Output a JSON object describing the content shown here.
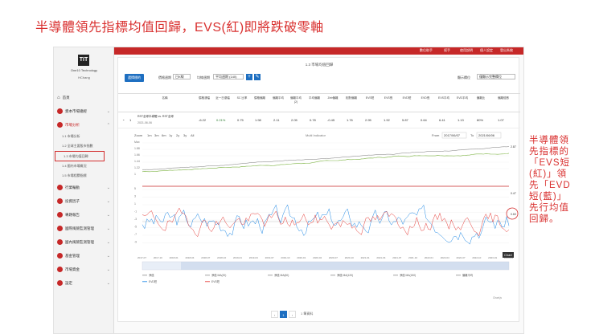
{
  "slide": {
    "title": "半導體領先指標均值回歸，EVS(紅)即將跌破零軸",
    "note_lines": [
      "半導體領",
      "先指標的",
      "「EVS短",
      "(紅)」領",
      "先「EVD",
      "短(藍)」",
      "先行均值",
      "回歸。"
    ],
    "annotation_circle_value": "0.60"
  },
  "sidebar": {
    "logo_mark": "TIT",
    "logo_text": "One10 Technology",
    "user": "HChang",
    "items": [
      {
        "label": "首頁",
        "active": false
      },
      {
        "label": "資本市場總經",
        "active": false
      },
      {
        "label": "市場分析",
        "active": true
      },
      {
        "label": "行業輪動",
        "active": false
      },
      {
        "label": "投資因子",
        "active": false
      },
      {
        "label": "專題報告",
        "active": false
      },
      {
        "label": "國際風險監測管理",
        "active": false
      },
      {
        "label": "國內風險監測管理",
        "active": false
      },
      {
        "label": "基金管理",
        "active": false
      },
      {
        "label": "市場資金",
        "active": false
      },
      {
        "label": "設定",
        "active": false
      }
    ],
    "subitems": [
      {
        "label": "1.1 市場分析",
        "active": false
      },
      {
        "label": "1.2 全球主要股市指數",
        "active": false
      },
      {
        "label": "1.3 市場均值回歸",
        "active": true
      },
      {
        "label": "1.4 國內市場概況",
        "active": false
      },
      {
        "label": "1.5 市場相關指標",
        "active": false
      }
    ]
  },
  "topbar": {
    "links": [
      "數位助手",
      "幫手",
      "使用說明",
      "個人設定",
      "登出系統"
    ]
  },
  "panel": {
    "title": "1.3 市場均值回歸",
    "add_button": "選擇標的",
    "freq_label": "價格週期",
    "freq_value": "日K線",
    "ma_label": "均線週期",
    "ma_value": "平均週期 (140)",
    "display_label": "顯示欄位",
    "display_value": "僅顯示完整欄位"
  },
  "table": {
    "headers": [
      "名稱",
      "價格漲幅",
      "近一日漲幅",
      "SC 比率",
      "價格偏離",
      "偏離平均",
      "偏離平均(2)",
      "平均偏離",
      "Zeb偏離",
      "相對偏離",
      "EVS短",
      "EVS長",
      "EVD短",
      "EVD長",
      "EVS平均",
      "EVD平均",
      "偏離比",
      "偏離倍數"
    ],
    "row": {
      "index": "1",
      "name": "RST全球半導體 vs. RST全球",
      "date": "2021-06-06",
      "values": [
        "-6.22",
        "0.21%",
        "0.75",
        "1.98",
        "2.11",
        "2.05",
        "0.78",
        "-0.45",
        "1.76",
        "2.95",
        "1.92",
        "5.87",
        "0.64",
        "6.41",
        "1.13",
        "80%",
        "1.07"
      ]
    }
  },
  "chart": {
    "zoom_label": "Zoom",
    "zoom_buttons": [
      "1m",
      "3m",
      "6m",
      "1y",
      "2y",
      "3y",
      "All"
    ],
    "center_label": "Multi Indicator",
    "from_label": "From",
    "from_value": "2017/06/07",
    "to_label": "To",
    "to_value": "2021/06/06",
    "tooltip": "Chart",
    "right_labels": [
      "2.87",
      "0.47",
      "0.60"
    ],
    "left_ticks": [
      "Max",
      "1.88",
      "1.66",
      "1.44",
      "1.22",
      "1",
      "5",
      "3",
      "1",
      "-1",
      "-3",
      "-5",
      "-7",
      "-9"
    ],
    "x_ticks": [
      "2017-07",
      "2017-10",
      "2018-01",
      "2018-04",
      "2018-07",
      "2018-10",
      "2019-01",
      "2019-04",
      "2019-07",
      "2019-10",
      "2020-01",
      "2020-04",
      "2020-07",
      "2020-10",
      "2021-01",
      "2021-04",
      "2021-07",
      "2021-10",
      "2022-01",
      "2022-04",
      "2022-07",
      "2022-10",
      "2023-01",
      "2023-04"
    ],
    "legend": [
      "淨值",
      "淨值 MA(20)",
      "淨值 MA(60)",
      "淨值 MA(120)",
      "淨值 MA(150)",
      "偏離平均",
      "EVD短",
      "EVS短"
    ],
    "footer": "Chart.js"
  },
  "pager": {
    "pages": [
      "‹",
      "1",
      "›"
    ],
    "current": "1",
    "total_label": "1 筆資料"
  }
}
